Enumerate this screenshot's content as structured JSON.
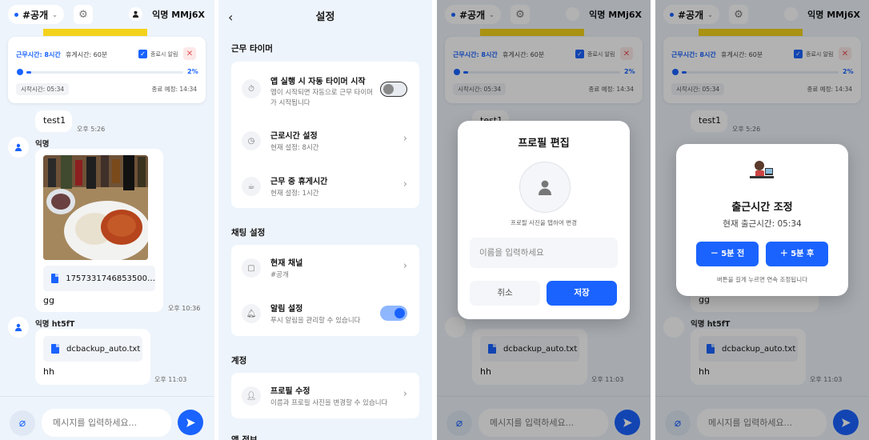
{
  "chat": {
    "channel": "#공개",
    "user_name": "익명 MMj6X",
    "timer": {
      "work_time": "근무시간: 8시간",
      "break_time": "휴게시간: 60분",
      "end_notify": "종료시 알림",
      "progress_pct": "2%",
      "progress_value": 0.02,
      "start_time": "시작시간: 05:34",
      "end_time": "종료 예정: 14:34"
    },
    "messages": [
      {
        "text": "test1",
        "time": "오후 5:26"
      },
      {
        "sender": "익명",
        "file": "1757331746853500…",
        "text": "gg",
        "time": "오후 10:36"
      },
      {
        "sender": "익명 ht5fT",
        "file": "dcbackup_auto.txt",
        "text": "hh",
        "time": "오후 11:03"
      }
    ],
    "input_placeholder": "메시지를 입력하세요..."
  },
  "settings": {
    "title": "설정",
    "sections": {
      "timer": "근무 타이머",
      "chat": "채팅 설정",
      "account": "계정",
      "app_info": "앱 정보"
    },
    "auto_timer_title": "앱 실행 시 자동 타이머 시작",
    "auto_timer_sub_1": "앱이 시작되면 자동으로 근무 타이머",
    "auto_timer_sub_2": "가 시작됩니다",
    "work_time_title": "근로시간 설정",
    "work_time_sub": "현재 설정: 8시간",
    "break_title": "근무 중 휴게시간",
    "break_sub": "현재 설정: 1시간",
    "channel_title": "현재 채널",
    "channel_sub": "#공개",
    "notify_title": "알림 설정",
    "notify_sub": "푸시 알림을 관리할 수 있습니다",
    "profile_title": "프로필 수정",
    "profile_sub": "이름과 프로필 사진을 변경할 수 있습니다"
  },
  "profile_modal": {
    "title": "프로필 편집",
    "hint": "프로필 사진을 탭하여 변경",
    "name_placeholder": "이름을 입력하세요",
    "cancel": "취소",
    "save": "저장"
  },
  "clockin_modal": {
    "title": "출근시간 조정",
    "current": "현재 출근시간: 05:34",
    "minus": "－ 5분 전",
    "plus": "＋ 5분 후",
    "hint": "버튼을 길게 누르면 연속 조정됩니다"
  },
  "colors": {
    "accent": "#1a63ff",
    "background": "#eef4fb",
    "warning_yellow": "#f4d21c"
  }
}
